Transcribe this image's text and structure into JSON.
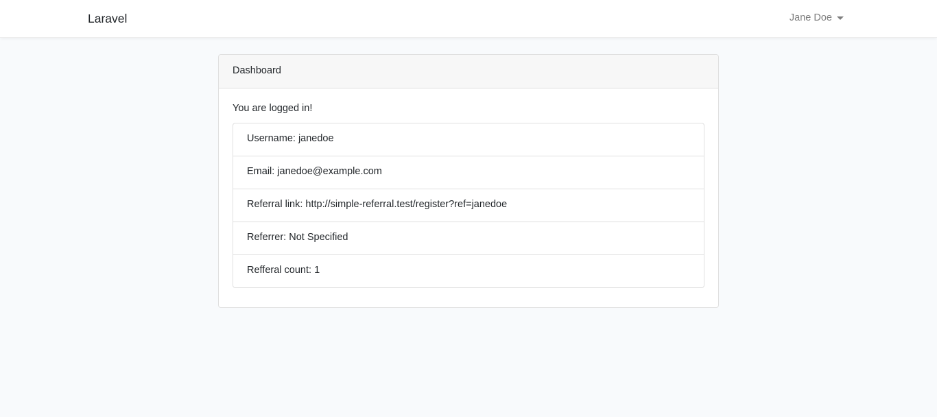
{
  "navbar": {
    "brand": "Laravel",
    "user_name": "Jane Doe"
  },
  "card": {
    "header": "Dashboard",
    "status": "You are logged in!",
    "items": [
      "Username: janedoe",
      "Email: janedoe@example.com",
      "Referral link: http://simple-referral.test/register?ref=janedoe",
      "Referrer: Not Specified",
      "Refferal count: 1"
    ]
  },
  "icons": {
    "user_menu": "caret-down-icon"
  },
  "colors": {
    "background": "#f8fafc",
    "navbar": "#ffffff",
    "card_header": "#f7f7f7",
    "border": "#dfdfdf"
  }
}
